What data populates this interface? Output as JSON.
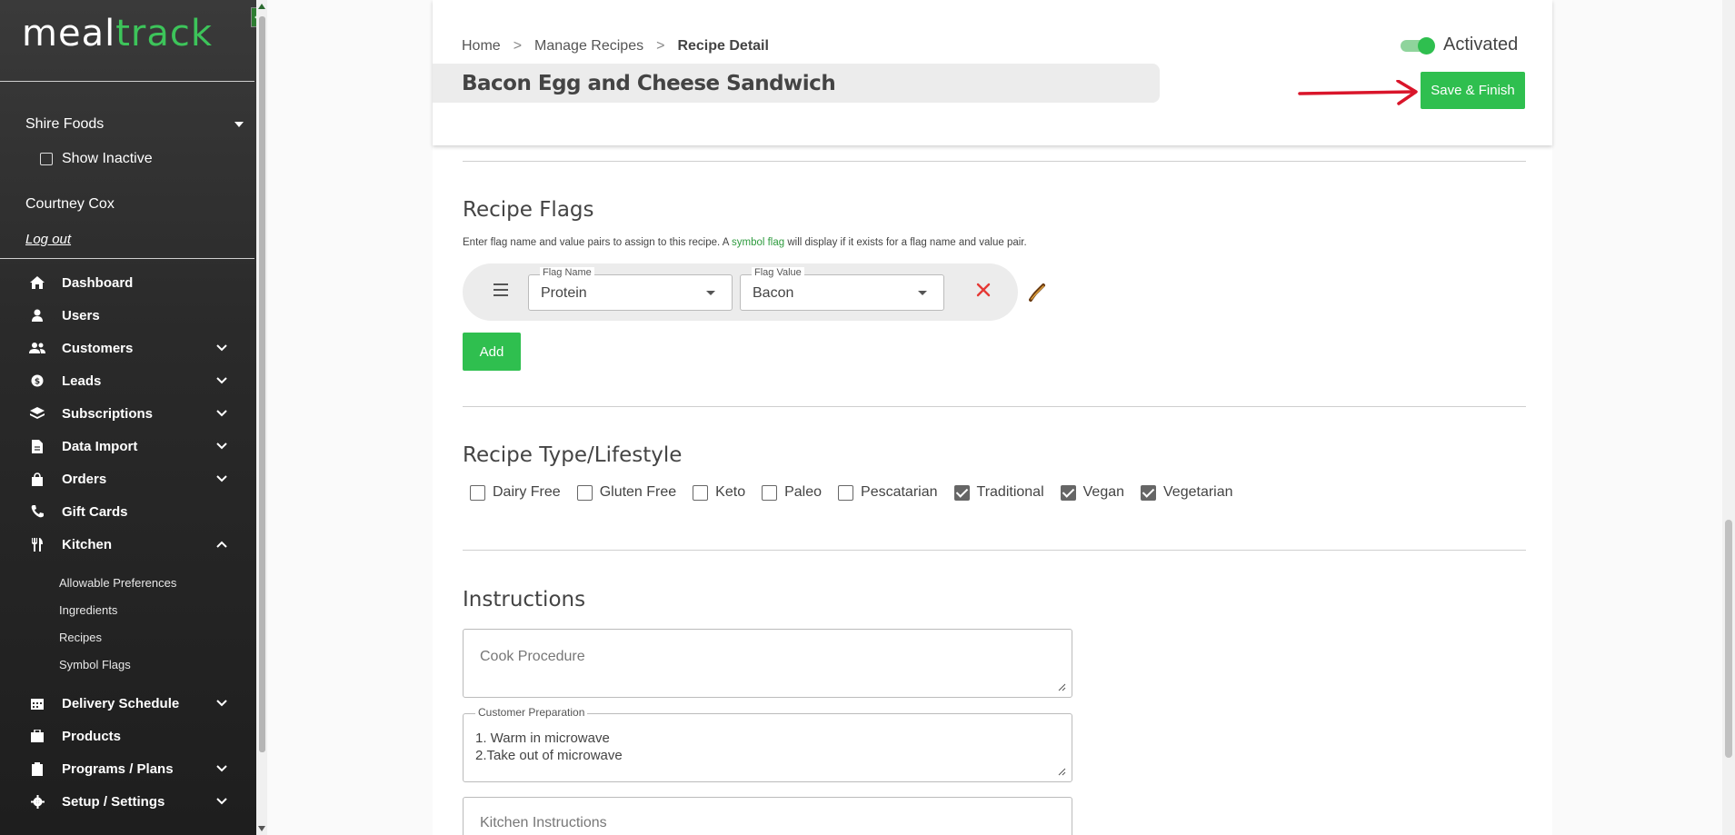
{
  "brand": {
    "meal": "meal",
    "track": "track"
  },
  "sidebar": {
    "account": "Shire Foods",
    "show_inactive": "Show Inactive",
    "user": "Courtney Cox",
    "logout": "Log out",
    "nav": [
      {
        "label": "Dashboard",
        "icon": "home-icon"
      },
      {
        "label": "Users",
        "icon": "user-icon"
      },
      {
        "label": "Customers",
        "icon": "users-icon"
      },
      {
        "label": "Leads",
        "icon": "dollar-icon"
      },
      {
        "label": "Subscriptions",
        "icon": "layers-icon"
      },
      {
        "label": "Data Import",
        "icon": "file-icon"
      },
      {
        "label": "Orders",
        "icon": "bag-icon"
      },
      {
        "label": "Gift Cards",
        "icon": "phone-icon"
      },
      {
        "label": "Kitchen",
        "icon": "utensils-icon"
      },
      {
        "label": "Delivery Schedule",
        "icon": "calendar-icon"
      },
      {
        "label": "Products",
        "icon": "box-icon"
      },
      {
        "label": "Programs / Plans",
        "icon": "clipboard-icon"
      },
      {
        "label": "Setup / Settings",
        "icon": "gear-icon"
      }
    ],
    "kitchen_sub": [
      "Allowable Preferences",
      "Ingredients",
      "Recipes",
      "Symbol Flags"
    ]
  },
  "breadcrumb": {
    "home": "Home",
    "manage": "Manage Recipes",
    "current": "Recipe Detail",
    "separator": ">"
  },
  "recipe": {
    "title": "Bacon Egg and Cheese Sandwich",
    "status": "Activated",
    "save_label": "Save & Finish"
  },
  "flags": {
    "title": "Recipe Flags",
    "help_before": "Enter flag name and value pairs to assign to this recipe. A ",
    "help_link": "symbol flag",
    "help_after": " will display if it exists for a flag name and value pair.",
    "name_label": "Flag Name",
    "name_value": "Protein",
    "value_label": "Flag Value",
    "value_value": "Bacon",
    "add_label": "Add"
  },
  "lifestyle": {
    "title": "Recipe Type/Lifestyle",
    "options": [
      {
        "label": "Dairy Free",
        "checked": false
      },
      {
        "label": "Gluten Free",
        "checked": false
      },
      {
        "label": "Keto",
        "checked": false
      },
      {
        "label": "Paleo",
        "checked": false
      },
      {
        "label": "Pescatarian",
        "checked": false
      },
      {
        "label": "Traditional",
        "checked": true
      },
      {
        "label": "Vegan",
        "checked": true
      },
      {
        "label": "Vegetarian",
        "checked": true
      }
    ]
  },
  "instructions": {
    "title": "Instructions",
    "cook_placeholder": "Cook Procedure",
    "customer_label": "Customer Preparation",
    "customer_value": "1. Warm in microwave\n2.Take out of microwave",
    "kitchen_placeholder": "Kitchen Instructions"
  },
  "colors": {
    "accent": "#2fbf4f",
    "annotation": "#d9152a"
  }
}
